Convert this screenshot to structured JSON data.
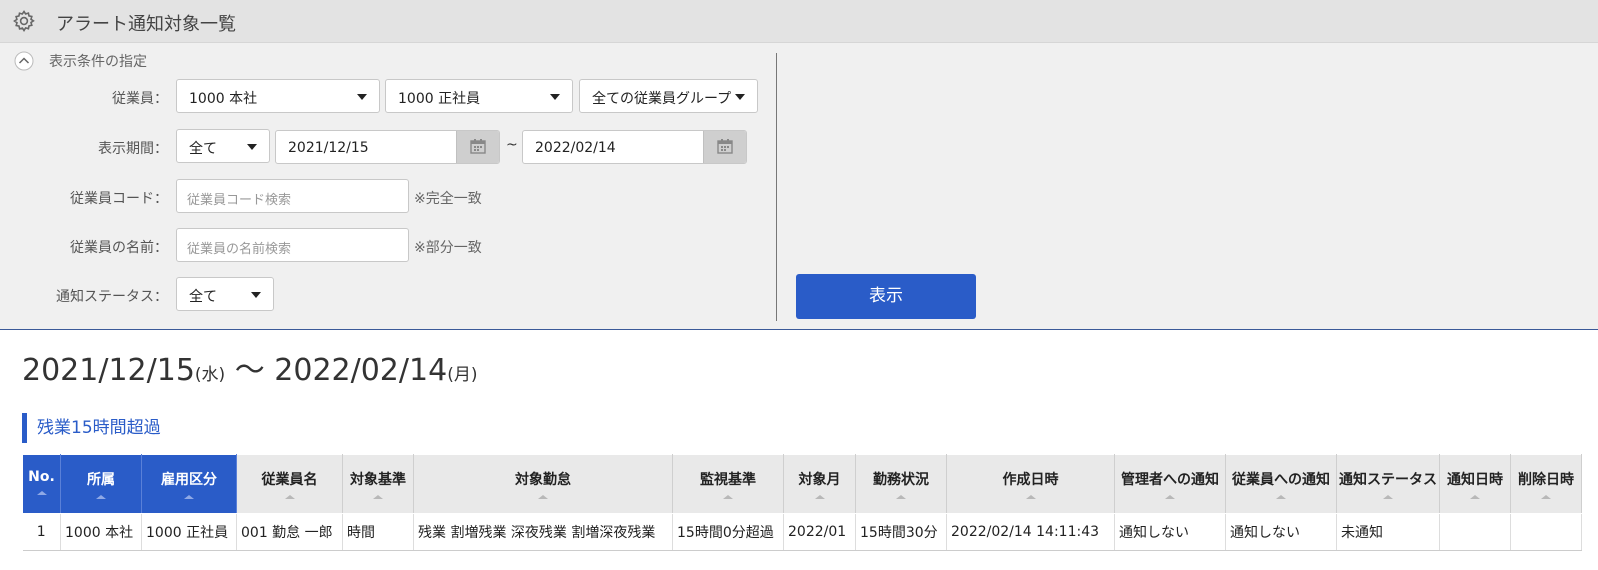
{
  "header": {
    "title": "アラート通知対象一覧",
    "icon": "gear-icon"
  },
  "filter": {
    "toggle_label": "表示条件の指定",
    "employee_label": "従業員：",
    "employee_office": "1000 本社",
    "employee_type": "1000 正社員",
    "employee_group": "全ての従業員グループ",
    "period_label": "表示期間：",
    "period_mode": "全て",
    "date_from": "2021/12/15",
    "tilde": "~",
    "date_to": "2022/02/14",
    "code_label": "従業員コード：",
    "code_placeholder": "従業員コード検索",
    "code_note": "※完全一致",
    "name_label": "従業員の名前：",
    "name_placeholder": "従業員の名前検索",
    "name_note": "※部分一致",
    "status_label": "通知ステータス：",
    "status_value": "全て",
    "show_button": "表示"
  },
  "result": {
    "range_from": "2021/12/15",
    "range_from_dow": "(水)",
    "range_sep": " 〜 ",
    "range_to": "2022/02/14",
    "range_to_dow": "(月)",
    "section_title": "残業15時間超過",
    "columns": [
      "No.",
      "所属",
      "雇用区分",
      "従業員名",
      "対象基準",
      "対象勤怠",
      "監視基準",
      "対象月",
      "勤務状況",
      "作成日時",
      "管理者への通知",
      "従業員への通知",
      "通知ステータス",
      "通知日時",
      "削除日時"
    ],
    "rows": [
      [
        "1",
        "1000 本社",
        "1000 正社員",
        "001 勤怠 一郎",
        "時間",
        "残業 割増残業 深夜残業 割増深夜残業",
        "15時間0分超過",
        "2022/01",
        "15時間30分",
        "2022/02/14 14:11:43",
        "通知しない",
        "通知しない",
        "未通知",
        "",
        ""
      ]
    ]
  },
  "colors": {
    "accent": "#2a5cc8",
    "header_bg": "#e3e3e3",
    "panel_bg": "#f0f0f0"
  }
}
